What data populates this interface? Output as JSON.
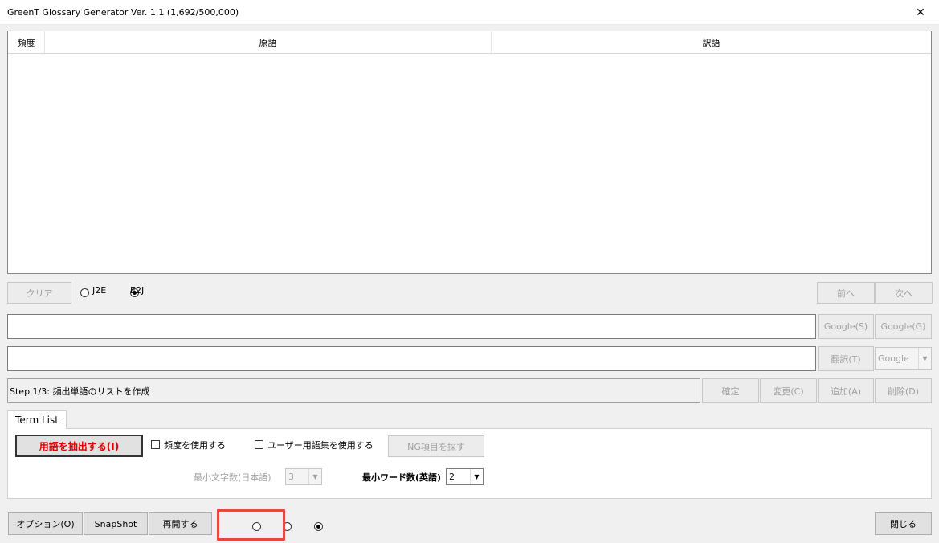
{
  "window": {
    "title": "GreenT Glossary Generator Ver. 1.1 (1,692/500,000)",
    "close_glyph": "✕"
  },
  "term_table": {
    "columns": [
      "頻度",
      "原語",
      "訳語"
    ]
  },
  "controls": {
    "clear_label": "クリア",
    "direction_options": [
      {
        "label": "J2E",
        "selected": false
      },
      {
        "label": "E2J",
        "selected": true
      }
    ],
    "prev_label": "前へ",
    "next_label": "次へ",
    "google_s_label": "Google(S)",
    "google_g_label": "Google(G)",
    "translate_label": "翻訳(T)",
    "engine_select": "Google"
  },
  "status": {
    "text": "Step 1/3: 頻出単語のリストを作成",
    "confirm_label": "確定",
    "change_label": "変更(C)",
    "add_label": "追加(A)",
    "delete_label": "削除(D)"
  },
  "tab": {
    "label": "Term List",
    "extract_label": "用語を抽出する(I)",
    "use_frequency_label": "頻度を使用する",
    "use_user_glossary_label": "ユーザー用語集を使用する",
    "find_ng_label": "NG項目を探す",
    "min_chars_label": "最小文字数(日本語)",
    "min_chars_value": "3",
    "min_words_label": "最小ワード数(英語)",
    "min_words_value": "2"
  },
  "footer": {
    "options_label": "オプション(O)",
    "snapshot_label": "SnapShot",
    "resume_label": "再開する",
    "close_label": "閉じる",
    "snapshot_radios": [
      false,
      false,
      true
    ]
  },
  "colors": {
    "accent_red": "#e8473e",
    "extract_text": "#e00000"
  }
}
